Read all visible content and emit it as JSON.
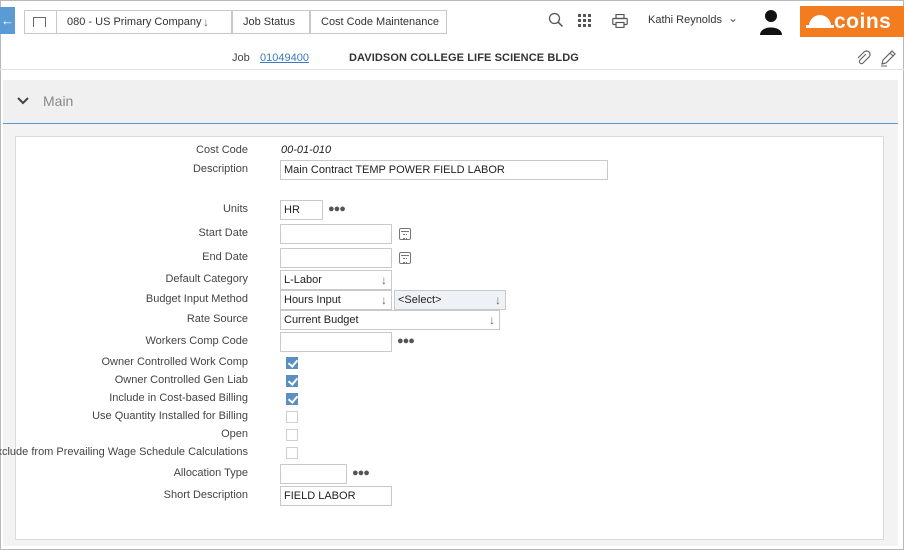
{
  "topbar": {
    "company_crumb": "080 - US Primary Company",
    "job_status_crumb": "Job Status",
    "cost_code_crumb": "Cost Code Maintenance",
    "user_name": "Kathi Reynolds",
    "logo_text": "coins",
    "brand_color": "#f37b20",
    "accent_color": "#5b9bd5"
  },
  "job": {
    "label": "Job",
    "number": "01049400",
    "name": "DAVIDSON COLLEGE LIFE SCIENCE BLDG"
  },
  "section": {
    "title": "Main"
  },
  "form": {
    "cost_code": {
      "label": "Cost Code",
      "value": "00-01-010"
    },
    "description": {
      "label": "Description",
      "value": "Main Contract TEMP POWER FIELD LABOR"
    },
    "units": {
      "label": "Units",
      "value": "HR"
    },
    "start_date": {
      "label": "Start Date",
      "value": ""
    },
    "end_date": {
      "label": "End Date",
      "value": ""
    },
    "default_category": {
      "label": "Default Category",
      "value": "L-Labor"
    },
    "budget_input_method": {
      "label": "Budget Input Method",
      "value": "Hours Input",
      "secondary_value": "<Select>"
    },
    "rate_source": {
      "label": "Rate Source",
      "value": "Current Budget"
    },
    "workers_comp_code": {
      "label": "Workers Comp Code",
      "value": ""
    },
    "owner_controlled_work_comp": {
      "label": "Owner Controlled Work Comp",
      "checked": true
    },
    "owner_controlled_gen_liab": {
      "label": "Owner Controlled Gen Liab",
      "checked": true
    },
    "include_cost_based_billing": {
      "label": "Include in Cost-based Billing",
      "checked": true
    },
    "use_quantity_installed": {
      "label": "Use Quantity Installed for Billing",
      "checked": false
    },
    "open": {
      "label": "Open",
      "checked": false
    },
    "exclude_prevailing_wage": {
      "label": "Exclude from Prevailing Wage Schedule Calculations",
      "checked": false
    },
    "allocation_type": {
      "label": "Allocation Type",
      "value": ""
    },
    "short_description": {
      "label": "Short Description",
      "value": "FIELD LABOR"
    }
  }
}
